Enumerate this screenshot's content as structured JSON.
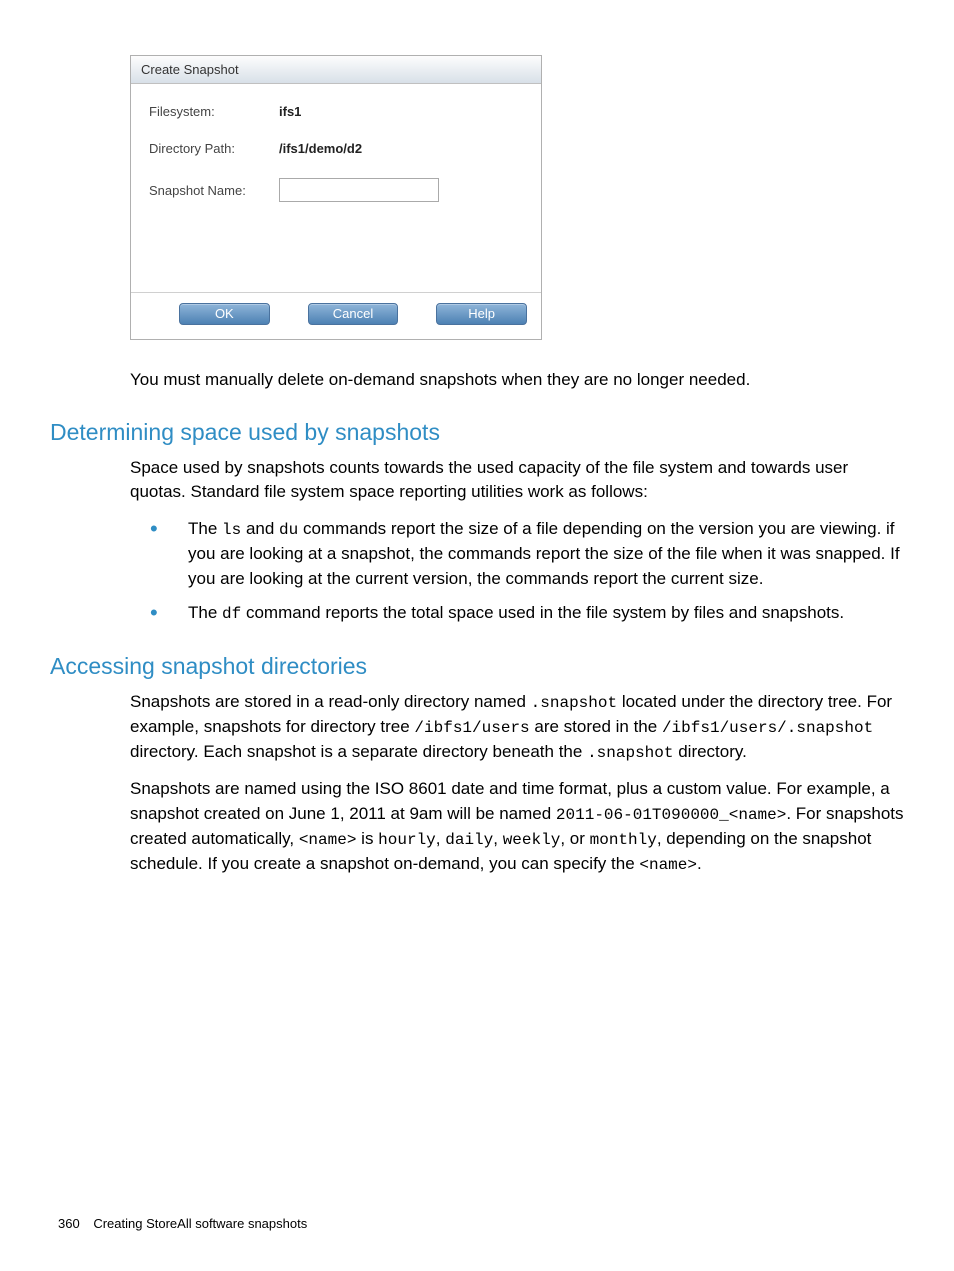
{
  "dialog": {
    "title": "Create Snapshot",
    "filesystem_label": "Filesystem:",
    "filesystem_value": "ifs1",
    "dirpath_label": "Directory Path:",
    "dirpath_value": "/ifs1/demo/d2",
    "snapname_label": "Snapshot Name:",
    "snapname_value": "",
    "ok": "OK",
    "cancel": "Cancel",
    "help": "Help"
  },
  "para_after_dialog": "You must manually delete on-demand snapshots when they are no longer needed.",
  "heading1": "Determining space used by snapshots",
  "para1": "Space used by snapshots counts towards the used capacity of the file system and towards user quotas. Standard file system space reporting utilities work as follows:",
  "bullet1_a": "The ",
  "bullet1_code1": "ls",
  "bullet1_b": " and ",
  "bullet1_code2": "du",
  "bullet1_c": " commands report the size of a file depending on the version you are viewing. if you are looking at a snapshot, the commands report the size of the file when it was snapped. If you are looking at the current version, the commands report the current size.",
  "bullet2_a": "The ",
  "bullet2_code1": "df",
  "bullet2_b": " command reports the total space used in the file system by files and snapshots.",
  "heading2": "Accessing snapshot directories",
  "para2_a": "Snapshots are stored in a read-only directory named ",
  "para2_code1": ".snapshot",
  "para2_b": " located under the directory tree. For example, snapshots for directory tree ",
  "para2_code2": "/ibfs1/users",
  "para2_c": " are stored in the ",
  "para2_code3": "/ibfs1/users/.snapshot",
  "para2_d": " directory. Each snapshot is a separate directory beneath the ",
  "para2_code4": ".snapshot",
  "para2_e": " directory.",
  "para3_a": "Snapshots are named using the ISO 8601 date and time format, plus a custom value. For example, a snapshot created on June 1, 2011 at 9am will be named ",
  "para3_code1": "2011-06-01T090000_<name>",
  "para3_b": ". For snapshots created automatically, ",
  "para3_code2": "<name>",
  "para3_c": " is ",
  "para3_code3": "hourly",
  "para3_d": ", ",
  "para3_code4": "daily",
  "para3_e": ", ",
  "para3_code5": "weekly",
  "para3_f": ", or ",
  "para3_code6": "monthly",
  "para3_g": ", depending on the snapshot schedule. If you create a snapshot on-demand, you can specify the ",
  "para3_code7": "<name>",
  "para3_h": ".",
  "footer": {
    "pagenum": "360",
    "chapter": "Creating StoreAll software snapshots"
  }
}
